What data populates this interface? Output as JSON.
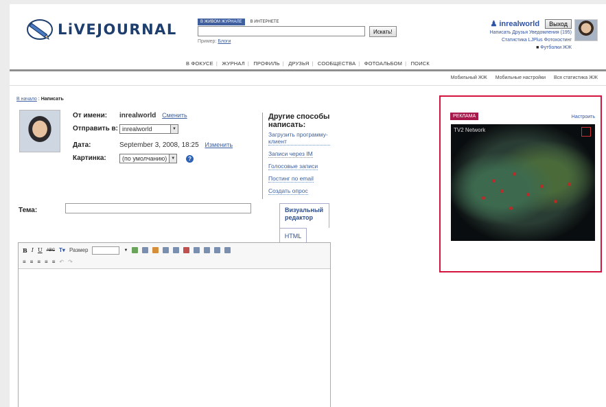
{
  "header": {
    "logo_text": "LiVEJOURNAL",
    "search_tabs": [
      "В ЖИВОМ ЖУРНАЛЕ",
      "В ИНТЕРНЕТЕ"
    ],
    "search_button": "Искать!",
    "search_example_label": "Пример:",
    "search_example_link": "Блоги"
  },
  "user": {
    "name": "inrealworld",
    "exit_button": "Выход",
    "links_row1": [
      "Написать",
      "Друзья",
      "Уведомления (195)"
    ],
    "links_row2": [
      "Статистика",
      "LJPlus",
      "Фотохостинг"
    ],
    "tshirts": "Футболки ЖЖ"
  },
  "mainnav": [
    "В ФОКУСЕ",
    "ЖУРНАЛ",
    "ПРОФИЛЬ",
    "ДРУЗЬЯ",
    "СООБЩЕСТВА",
    "ФОТОАЛЬБОМ",
    "ПОИСК"
  ],
  "subnav": [
    "Мобильный ЖЖ",
    "Мобильные настройки",
    "Вся статистика ЖЖ"
  ],
  "breadcrumb": {
    "home": "В начало",
    "sep": ":",
    "current": "Написать"
  },
  "form": {
    "from_label": "От имени:",
    "from_value": "inrealworld",
    "change_link": "Сменить",
    "send_label": "Отправить в:",
    "send_value": "inrealworld",
    "date_label": "Дата:",
    "date_value": "September 3, 2008, 18:25",
    "date_change": "Изменить",
    "picture_label": "Картинка:",
    "picture_value": "(по умолчанию)",
    "topic_label": "Тема:"
  },
  "other_ways": {
    "title": "Другие способы написать:",
    "items": [
      "Загрузить программу-клиент",
      "Записи через IM",
      "Голосовые записи",
      "Постинг по email",
      "Создать опрос"
    ]
  },
  "editor": {
    "tab_visual": "Визуальный редактор",
    "tab_html": "HTML",
    "size_label": "Размер"
  },
  "ad": {
    "label": "РЕКЛАМА",
    "setup_link": "Настроить",
    "network": "TV2 Network"
  }
}
